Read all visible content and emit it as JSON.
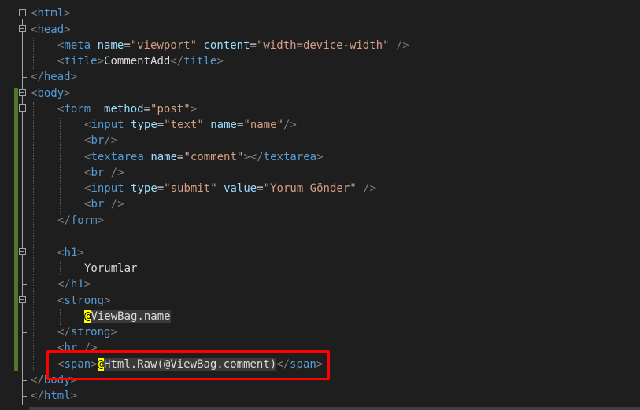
{
  "code": {
    "meta_content": "width=device-width",
    "title_text": "CommentAdd",
    "form_method": "post",
    "input1_type": "text",
    "input1_name": "name",
    "textarea_name": "comment",
    "submit_type": "submit",
    "submit_value": "Yorum Gönder",
    "h1_text": "Yorumlar",
    "viewbag_name": "ViewBag.name",
    "span_expression": "Html.Raw(@ViewBag.comment)"
  },
  "colors": {
    "tag": "#569cd6",
    "attribute": "#9cdcfe",
    "string": "#d69d85",
    "text": "#dcdcdc",
    "razor_marker": "#ffff00",
    "highlight_box": "#ff0000"
  }
}
